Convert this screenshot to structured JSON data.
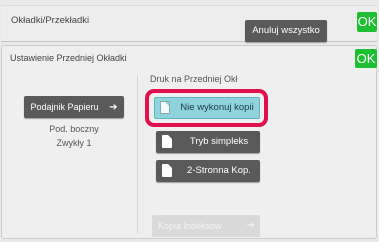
{
  "header": {
    "title": "Okładki/Przekładki",
    "reset_label": "Anuluj wszystko",
    "ok_label": "OK"
  },
  "panel": {
    "title": "Ustawienie Przedniej Okładki",
    "ok_label": "OK",
    "paper_tray": {
      "button_label": "Podajnik Papieru",
      "button_icon": "arrow-right-icon",
      "tray_name": "Pod. boczny",
      "paper_type": "Zwykły 1"
    },
    "print_section": {
      "label": "Druk na Przedniej Okł",
      "options": [
        {
          "label": "Nie wykonuj kopii",
          "selected": true,
          "icon": "blank-page-icon"
        },
        {
          "label": "Tryb simpleks",
          "selected": false,
          "icon": "simplex-page-icon"
        },
        {
          "label": "2-Stronna Kop.",
          "selected": false,
          "icon": "duplex-page-icon"
        }
      ]
    },
    "index_copy": {
      "label": "Kopia Indeksów",
      "enabled": false
    }
  },
  "colors": {
    "accent_ok": "#1fbf34",
    "selected_option": "#8fd3dd",
    "highlight_ring": "#e0104d",
    "button_dark": "#5a5a5a"
  }
}
